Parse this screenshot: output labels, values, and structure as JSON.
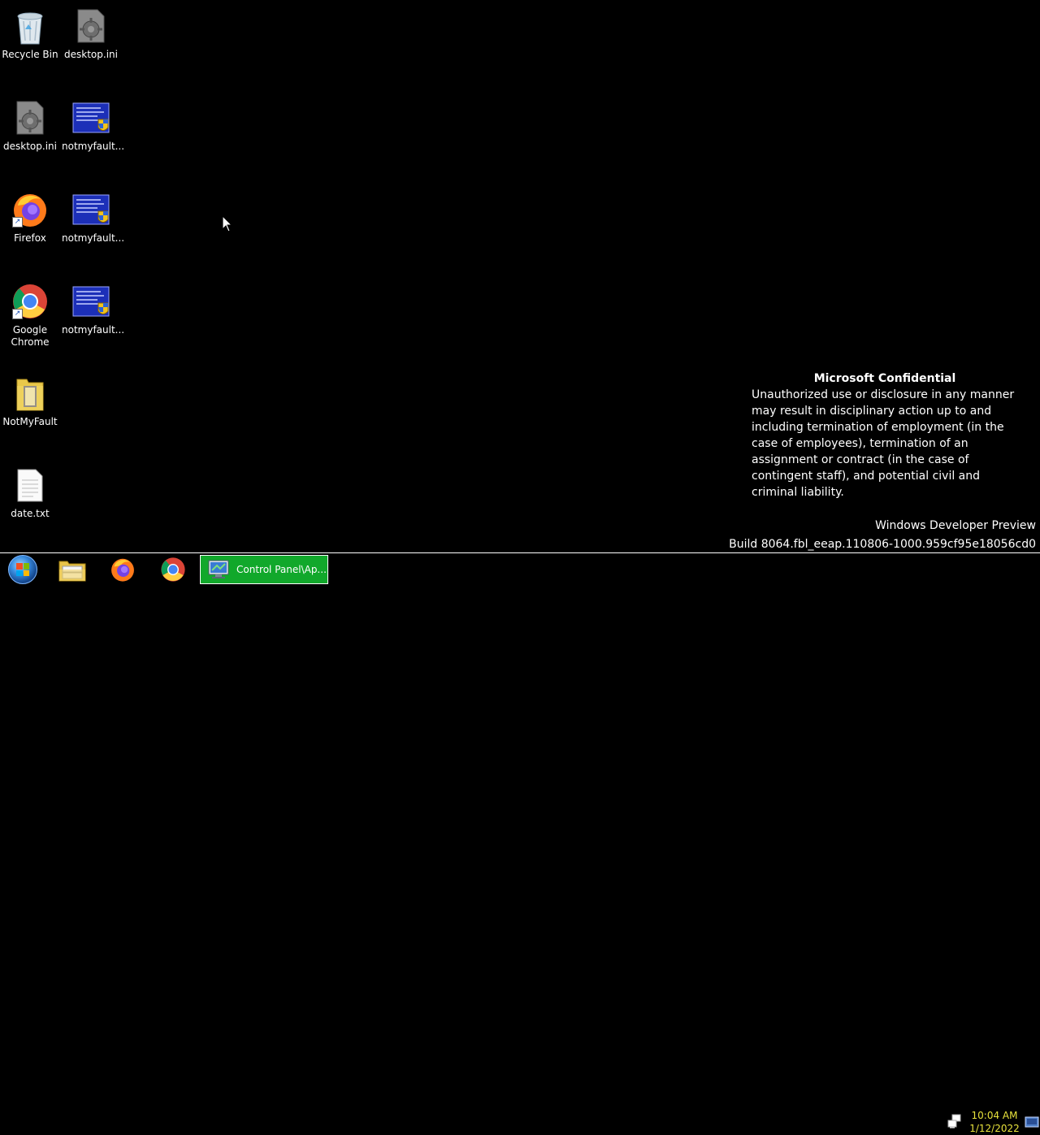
{
  "desktop": {
    "icons": [
      {
        "label": "Recycle Bin",
        "icon": "recycle-bin-icon"
      },
      {
        "label": "desktop.ini",
        "icon": "settings-file-icon"
      },
      {
        "label": "desktop.ini",
        "icon": "settings-file-icon"
      },
      {
        "label": "notmyfault...",
        "icon": "notmyfault-app-icon"
      },
      {
        "label": "Firefox",
        "icon": "firefox-icon"
      },
      {
        "label": "notmyfault...",
        "icon": "notmyfault-app-icon"
      },
      {
        "label": "Google Chrome",
        "icon": "chrome-icon"
      },
      {
        "label": "notmyfault...",
        "icon": "notmyfault-app-icon"
      },
      {
        "label": "NotMyFault",
        "icon": "folder-icon"
      },
      {
        "label": "date.txt",
        "icon": "text-file-icon"
      }
    ]
  },
  "confidential": {
    "title": "Microsoft Confidential",
    "body": "Unauthorized use or disclosure in any manner may result in disciplinary action up to and including termination of employment (in the case of employees), termination of an assignment or contract (in the case of contingent staff), and potential civil and criminal liability."
  },
  "watermark": {
    "line1": "Windows Developer Preview",
    "line2": "Build 8064.fbl_eeap.110806-1000.959cf95e18056cd0"
  },
  "taskbar": {
    "pinned": [
      "windows-explorer-icon",
      "firefox-icon",
      "chrome-icon"
    ],
    "active_window_label": "Control Panel\\Ap...",
    "clock_time": "10:04 AM",
    "clock_date": "1/12/2022"
  },
  "colors": {
    "desktop_bg": "#000000",
    "active_task_bg": "#11a82b",
    "clock_text": "#e8e23c"
  }
}
